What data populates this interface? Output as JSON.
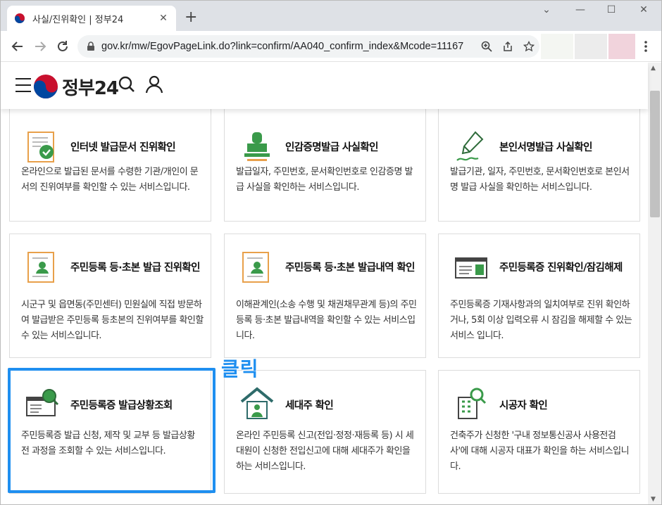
{
  "browser": {
    "tab_title": "사실/진위확인 | 정부24",
    "url": "gov.kr/mw/EgovPageLink.do?link=confirm/AA040_confirm_index&Mcode=11167",
    "colors": {
      "tabbar": "#dee1e6",
      "omnibox": "#f1f3f4"
    }
  },
  "site": {
    "logo_text": "정부24",
    "colors": {
      "accent": "#1f8ff0",
      "icon_green": "#3a9a4a",
      "icon_orange": "#e8a04a"
    }
  },
  "annotation": {
    "label": "클릭"
  },
  "cards": [
    {
      "icon": "document-check-icon",
      "title": "인터넷 발급문서 진위확인",
      "desc": "온라인으로 발급된 문서를 수령한 기관/개인이 문서의 진위여부를 확인할 수 있는 서비스입니다."
    },
    {
      "icon": "stamp-icon",
      "title": "인감증명발급 사실확인",
      "desc": "발급일자, 주민번호, 문서확인번호로 인감증명 발급 사실을 확인하는 서비스입니다."
    },
    {
      "icon": "pen-signature-icon",
      "title": "본인서명발급 사실확인",
      "desc": "발급기관, 일자, 주민번호, 문서확인번호로 본인서명 발급 사실을 확인하는 서비스입니다."
    },
    {
      "icon": "resident-register-icon",
      "title": "주민등록 등·초본 발급 진위확인",
      "desc": "시군구 및 읍면동(주민센터) 민원실에 직접 방문하여 발급받은 주민등록 등초본의 진위여부를 확인할 수 있는 서비스입니다."
    },
    {
      "icon": "resident-register-history-icon",
      "title": "주민등록 등·초본 발급내역 확인",
      "desc": "이해관계인(소송 수행 및 채권채무관계 등)의 주민등록 등·초본 발급내역을 확인할 수 있는 서비스입니다."
    },
    {
      "icon": "id-card-icon",
      "title": "주민등록증 진위확인/잠김해제",
      "desc": "주민등록증 기재사항과의 일치여부로 진위 확인하거나, 5회 이상 입력오류 시 잠김을 해제할 수 있는 서비스 입니다."
    },
    {
      "icon": "id-card-search-icon",
      "title": "주민등록증 발급상황조회",
      "desc": "주민등록증 발급 신청, 제작 및 교부 등 발급상황 전 과정을 조회할 수 있는 서비스입니다."
    },
    {
      "icon": "house-person-icon",
      "title": "세대주 확인",
      "desc": "온라인 주민등록 신고(전입·정정·재등록 등) 시 세대원이 신청한 전입신고에 대해 세대주가 확인을 하는 서비스입니다."
    },
    {
      "icon": "building-search-icon",
      "title": "시공자 확인",
      "desc": "건축주가 신청한 '구내 정보통신공사 사용전검사'에 대해 시공자 대표가 확인을 하는 서비스입니다."
    }
  ]
}
